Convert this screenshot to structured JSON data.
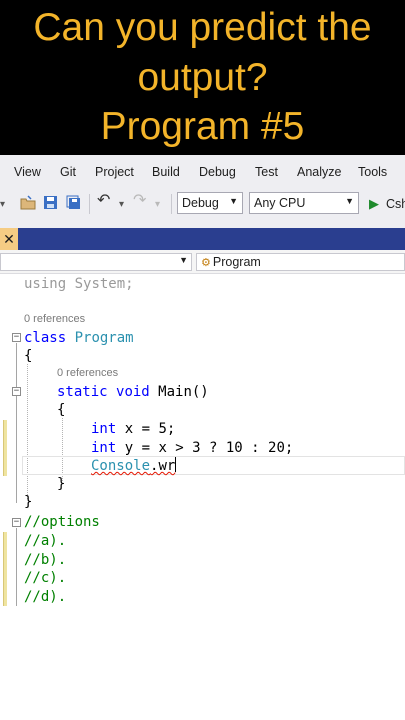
{
  "banner": {
    "line1": "Can you predict the",
    "line2": "output?",
    "line3": "Program #5",
    "color": "#f3b42a"
  },
  "menu": {
    "items": [
      "View",
      "Git",
      "Project",
      "Build",
      "Debug",
      "Test",
      "Analyze",
      "Tools"
    ]
  },
  "toolbar": {
    "config_value": "Debug",
    "platform_value": "Any CPU",
    "run_label": "Csh",
    "icons": [
      "open-folder-icon",
      "save-icon",
      "save-all-icon",
      "undo-icon",
      "redo-icon",
      "start-debug-icon"
    ]
  },
  "navbar": {
    "member_value": "Program"
  },
  "editor": {
    "using_kw": "using",
    "using_rest": " System;",
    "ref_class": "0 references",
    "class_kw": "class",
    "class_name": "Program",
    "brace_open": "{",
    "ref_main": "0 references",
    "static_kw": "static",
    "void_kw": "void",
    "main_sig": " Main()",
    "brace_open2": "{",
    "int_kw1": "int",
    "line_x": " x = 5;",
    "int_kw2": "int",
    "line_y": " y = x > 3 ? 10 : 20;",
    "console_type": "Console",
    "console_rest": ".wr",
    "brace_close2": "}",
    "brace_close": "}",
    "options_comment": "//options",
    "opt_a": "//a).",
    "opt_b": "//b).",
    "opt_c": "//c).",
    "opt_d": "//d)."
  }
}
